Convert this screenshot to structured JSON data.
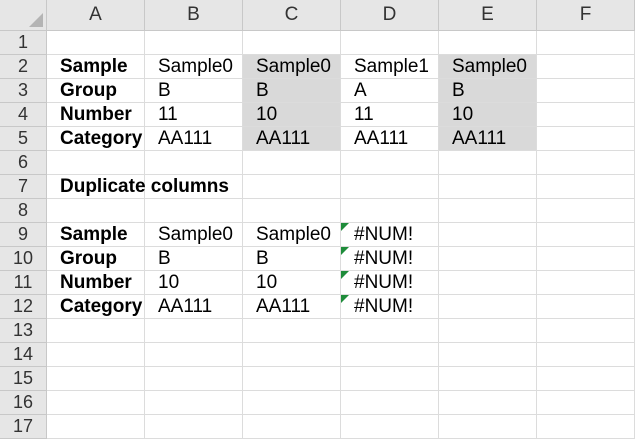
{
  "columns": [
    "A",
    "B",
    "C",
    "D",
    "E",
    "F"
  ],
  "rows": [
    "1",
    "2",
    "3",
    "4",
    "5",
    "6",
    "7",
    "8",
    "9",
    "10",
    "11",
    "12",
    "13",
    "14",
    "15",
    "16",
    "17"
  ],
  "cells": {
    "A2": "Sample",
    "B2": "Sample0",
    "C2": "Sample0",
    "D2": "Sample1",
    "E2": "Sample0",
    "A3": "Group",
    "B3": "B",
    "C3": "B",
    "D3": "A",
    "E3": "B",
    "A4": "Number",
    "B4": "11",
    "C4": "10",
    "D4": "11",
    "E4": "10",
    "A5": "Category",
    "B5": "AA111",
    "C5": "AA111",
    "D5": "AA111",
    "E5": "AA111",
    "A7": "Duplicate columns",
    "A9": "Sample",
    "B9": "Sample0",
    "C9": "Sample0",
    "D9": "#NUM!",
    "A10": "Group",
    "B10": "B",
    "C10": "B",
    "D10": "#NUM!",
    "A11": "Number",
    "B11": "10",
    "C11": "10",
    "D11": "#NUM!",
    "A12": "Category",
    "B12": "AA111",
    "C12": "AA111",
    "D12": "#NUM!"
  },
  "bold_cells": [
    "A2",
    "A3",
    "A4",
    "A5",
    "A7",
    "A9",
    "A10",
    "A11",
    "A12"
  ],
  "shaded_cells": [
    "C2",
    "C3",
    "C4",
    "C5",
    "E2",
    "E3",
    "E4",
    "E5"
  ],
  "error_flag_cells": [
    "D9",
    "D10",
    "D11",
    "D12"
  ],
  "colors": {
    "header_bg": "#e6e6e6",
    "shade": "#d9d9d9",
    "error_flag": "#1e8c3a"
  }
}
